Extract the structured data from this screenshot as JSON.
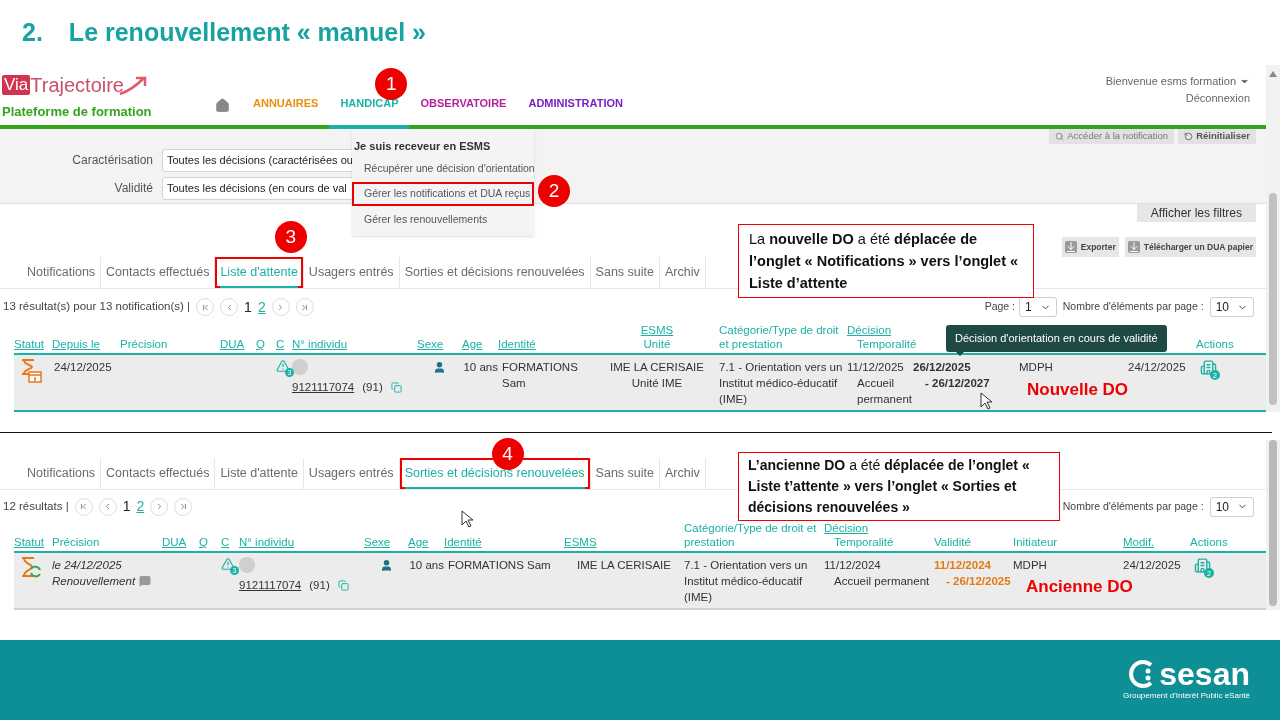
{
  "slide_title": {
    "number": "2.",
    "text": "Le renouvellement « manuel »"
  },
  "top_screenshot": {
    "logo": {
      "prefix": "Via",
      "name": "Trajectoire"
    },
    "platform": "Plateforme de formation",
    "nav": [
      {
        "label": "ANNUAIRES",
        "color": "#e8900c",
        "selected": false
      },
      {
        "label": "HANDICAP",
        "color": "#1bb1a6",
        "selected": true,
        "badge": "1"
      },
      {
        "label": "OBSERVATOIRE",
        "color": "#b2229a",
        "selected": false
      },
      {
        "label": "ADMINISTRATION",
        "color": "#7a1fc4",
        "selected": false
      }
    ],
    "user": {
      "greeting": "Bienvenue esms formation",
      "logout": "Déconnexion"
    },
    "filter_buttons": [
      {
        "label": "Accéder à la notification",
        "kind": "search"
      },
      {
        "label": "Réinitialiser",
        "kind": "reset"
      }
    ],
    "filters": [
      {
        "label": "Caractérisation",
        "value": "Toutes les décisions (caractérisées ou"
      },
      {
        "label": "Validité",
        "value": "Toutes les décisions (en cours de val"
      }
    ],
    "menu": {
      "heading": "Je suis receveur en ESMS",
      "items": [
        {
          "label": "Récupérer une décision d'orientation",
          "highlighted": false
        },
        {
          "label": "Gérer les notifications et DUA reçus",
          "highlighted": true,
          "badge": "2"
        },
        {
          "label": "Gérer les renouvellements",
          "highlighted": false
        }
      ]
    },
    "show_filters": "Afficher les filtres",
    "toolbar_buttons": [
      "Exporter",
      "Télécharger un DUA papier"
    ],
    "tabs": [
      {
        "label": "Notifications",
        "selected": false,
        "highlighted": false
      },
      {
        "label": "Contacts effectués",
        "selected": false,
        "highlighted": false
      },
      {
        "label": "Liste d'attente",
        "selected": true,
        "highlighted": true,
        "badge": "3"
      },
      {
        "label": "Usagers entrés",
        "selected": false,
        "highlighted": false
      },
      {
        "label": "Sorties et décisions renouvelées",
        "selected": false,
        "highlighted": false
      },
      {
        "label": "Sans suite",
        "selected": false,
        "highlighted": false
      },
      {
        "label": "Archiv",
        "selected": false,
        "highlighted": false
      }
    ],
    "results": "13 résultat(s) pour 13 notification(s) |",
    "pages": [
      {
        "label": "1",
        "selected": true
      },
      {
        "label": "2",
        "selected": false
      }
    ],
    "page_select": {
      "label": "Page :",
      "value": "1"
    },
    "per_page": {
      "label": "Nombre d'éléments par page :",
      "value": "10"
    },
    "columns": [
      {
        "label": "Statut",
        "sortable": true
      },
      {
        "label": "Depuis le",
        "sortable": true
      },
      {
        "label": "Précision",
        "sortable": false
      },
      {
        "label": "DUA",
        "sortable": true
      },
      {
        "label": "Q",
        "sortable": true
      },
      {
        "label": "C",
        "sortable": true
      },
      {
        "label": "N° individu",
        "sortable": true
      },
      {
        "label": "Sexe",
        "sortable": true
      },
      {
        "label": "Age",
        "sortable": true
      },
      {
        "label": "Identité",
        "sortable": true
      },
      {
        "label": "ESMS",
        "sublabel": "Unité",
        "sortable": true
      },
      {
        "label": "Catégorie/Type de droit et prestation",
        "sortable": false
      },
      {
        "label": "Décision",
        "sublabel": "Temporalité",
        "sortable": true
      },
      {
        "label": "Actions",
        "sortable": false
      }
    ],
    "rows": [
      {
        "kind": "waiting",
        "since": "24/12/2025",
        "c_badge": "3",
        "individual": "9121117074",
        "department": "(91)",
        "age": "10 ans",
        "identity": "FORMATIONS Sam",
        "esms": "IME LA CERISAIE",
        "unit": "Unité IME",
        "category": "7.1 - Orientation vers un Institut médico-éducatif (IME)",
        "decision_date": "11/12/2025",
        "temporality": "Accueil permanent",
        "validity": [
          "26/12/2025",
          "- 26/12/2027"
        ],
        "expired": false,
        "initiator": "MDPH",
        "modified": "24/12/2025",
        "action_badge": "2"
      }
    ],
    "tooltip": "Décision d'orientation en cours de validité",
    "callout": "La **nouvelle DO** a été **déplacée de l’onglet « Notifications » vers l’onglet « Liste d’attente**",
    "annotation": "Nouvelle DO"
  },
  "bottom_screenshot": {
    "tabs": [
      {
        "label": "Notifications",
        "selected": false,
        "highlighted": false
      },
      {
        "label": "Contacts effectués",
        "selected": false,
        "highlighted": false
      },
      {
        "label": "Liste d'attente",
        "selected": false,
        "highlighted": false
      },
      {
        "label": "Usagers entrés",
        "selected": false,
        "highlighted": false
      },
      {
        "label": "Sorties et décisions renouvelées",
        "selected": true,
        "highlighted": true,
        "badge": "4"
      },
      {
        "label": "Sans suite",
        "selected": false,
        "highlighted": false
      },
      {
        "label": "Archiv",
        "selected": false,
        "highlighted": false
      }
    ],
    "results": "12 résultats |",
    "pages": [
      {
        "label": "1",
        "selected": true
      },
      {
        "label": "2",
        "selected": false
      }
    ],
    "per_page": {
      "label": "Nombre d'éléments par page :",
      "value": "10"
    },
    "columns": [
      {
        "label": "Statut",
        "sortable": true
      },
      {
        "label": "Précision",
        "sortable": false
      },
      {
        "label": "DUA",
        "sortable": true
      },
      {
        "label": "Q",
        "sortable": true
      },
      {
        "label": "C",
        "sortable": true
      },
      {
        "label": "N° individu",
        "sortable": true
      },
      {
        "label": "Sexe",
        "sortable": true
      },
      {
        "label": "Age",
        "sortable": true
      },
      {
        "label": "Identité",
        "sortable": true
      },
      {
        "label": "ESMS",
        "sortable": true
      },
      {
        "label": "Catégorie/Type de droit et prestation",
        "sortable": false
      },
      {
        "label": "Décision",
        "sublabel": "Temporalité",
        "sortable": true
      },
      {
        "label": "Validité",
        "sortable": false
      },
      {
        "label": "Initiateur",
        "sortable": false
      },
      {
        "label": "Modif.",
        "sortable": true
      },
      {
        "label": "Actions",
        "sortable": false
      }
    ],
    "rows": [
      {
        "kind": "renewed",
        "precision": [
          "le 24/12/2025",
          "Renouvellement"
        ],
        "c_badge": "3",
        "individual": "9121117074",
        "department": "(91)",
        "age": "10 ans",
        "identity": "FORMATIONS Sam",
        "esms": "IME LA CERISAIE",
        "category": "7.1 - Orientation vers un Institut médico-éducatif (IME)",
        "decision_date": "11/12/2024",
        "temporality": "Accueil permanent",
        "validity": [
          "11/12/2024",
          "- 26/12/2025"
        ],
        "expired": true,
        "initiator": "MDPH",
        "modified": "24/12/2025",
        "action_badge": "2"
      }
    ],
    "callout": "**L’ancienne DO** a été **déplacée de l’onglet « Liste t’attente » vers l’onglet « Sorties et décisions renouvelées »**",
    "annotation": "Ancienne DO"
  },
  "footer": {
    "brand": "sesan",
    "tagline": "Groupement d'Intérêt Public eSanté"
  }
}
